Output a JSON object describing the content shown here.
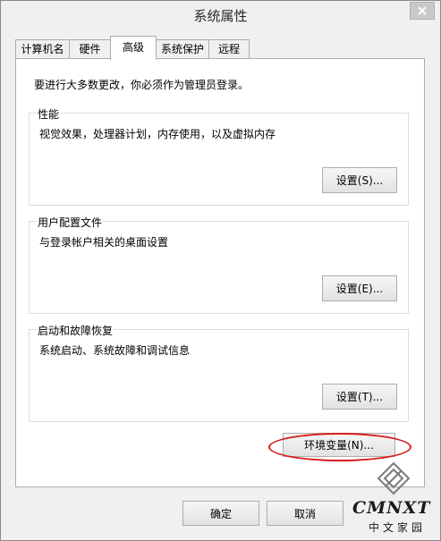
{
  "window": {
    "title": "系统属性"
  },
  "tabs": [
    {
      "label": "计算机名"
    },
    {
      "label": "硬件"
    },
    {
      "label": "高级"
    },
    {
      "label": "系统保护"
    },
    {
      "label": "远程"
    }
  ],
  "active_tab": "高级",
  "notice": "要进行大多数更改，你必须作为管理员登录。",
  "groups": {
    "performance": {
      "title": "性能",
      "description": "视觉效果，处理器计划，内存使用，以及虚拟内存",
      "button": "设置(S)..."
    },
    "user_profiles": {
      "title": "用户配置文件",
      "description": "与登录帐户相关的桌面设置",
      "button": "设置(E)..."
    },
    "startup_recovery": {
      "title": "启动和故障恢复",
      "description": "系统启动、系统故障和调试信息",
      "button": "设置(T)..."
    }
  },
  "env_button": "环境变量(N)...",
  "footer": {
    "ok": "确定",
    "cancel": "取消"
  },
  "watermark": {
    "text": "CMNXT",
    "subtext": "中文家园"
  },
  "colors": {
    "highlight_ellipse": "#d81e1e",
    "window_bg": "#f0f0f0",
    "panel_bg": "#ffffff"
  }
}
